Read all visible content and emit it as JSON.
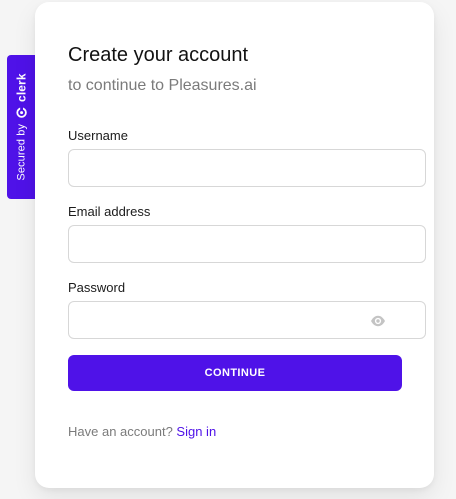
{
  "badge": {
    "secured_by": "Secured by",
    "brand": "clerk",
    "logo_icon": "clerk-logo-icon"
  },
  "form": {
    "title": "Create your account",
    "subtitle": "to continue to Pleasures.ai",
    "username": {
      "label": "Username",
      "value": ""
    },
    "email": {
      "label": "Email address",
      "value": ""
    },
    "password": {
      "label": "Password",
      "value": "",
      "toggle_icon": "eye-icon"
    },
    "continue_label": "Continue"
  },
  "footer": {
    "prompt": "Have an account?",
    "signin_label": "Sign in"
  },
  "colors": {
    "accent": "#4f12e8",
    "background": "#f5f5f5",
    "card": "#ffffff",
    "muted_text": "#7b7b7b",
    "border": "#d7d7d7"
  }
}
